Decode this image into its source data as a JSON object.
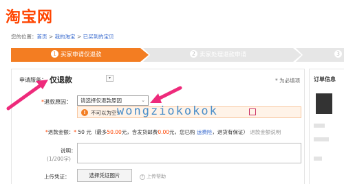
{
  "header": {
    "logo_text": "淘宝网"
  },
  "breadcrumb": {
    "prefix": "您的位置：",
    "items": [
      "首页",
      "我的淘宝",
      "已买到的宝贝"
    ],
    "separator": " > "
  },
  "steps": [
    {
      "num": "1",
      "label": "买家申请仅退款"
    },
    {
      "num": "2",
      "label": "卖家处理退款申请"
    },
    {
      "num": "3",
      "label": ""
    }
  ],
  "form": {
    "service_label": "申请服务：",
    "service_value": "仅退款",
    "required_note": "* 为必填项",
    "reason_label": "退款原因：",
    "reason_star": "*",
    "reason_placeholder": "请选择仅退款原因",
    "alert_text": "不可以为空!",
    "amount": {
      "star": "*",
      "label": "退款金额：",
      "value": "50",
      "unit": "元",
      "pre": "（最多",
      "max": "50.00",
      "mid": "元，含发货邮费",
      "postage": "0.00",
      "post": "元，您已购",
      "insurance": "运费险",
      "tail": "，退货有保证）",
      "help": "退款金额说明"
    },
    "desc_label": "说明：",
    "desc_count": "(1/200字)",
    "upload_label": "上传凭证：",
    "upload_button": "选择凭证图片",
    "upload_help": "上传帮助"
  },
  "sidebar": {
    "title": "订单信息"
  },
  "watermark": "wongziokokok"
}
